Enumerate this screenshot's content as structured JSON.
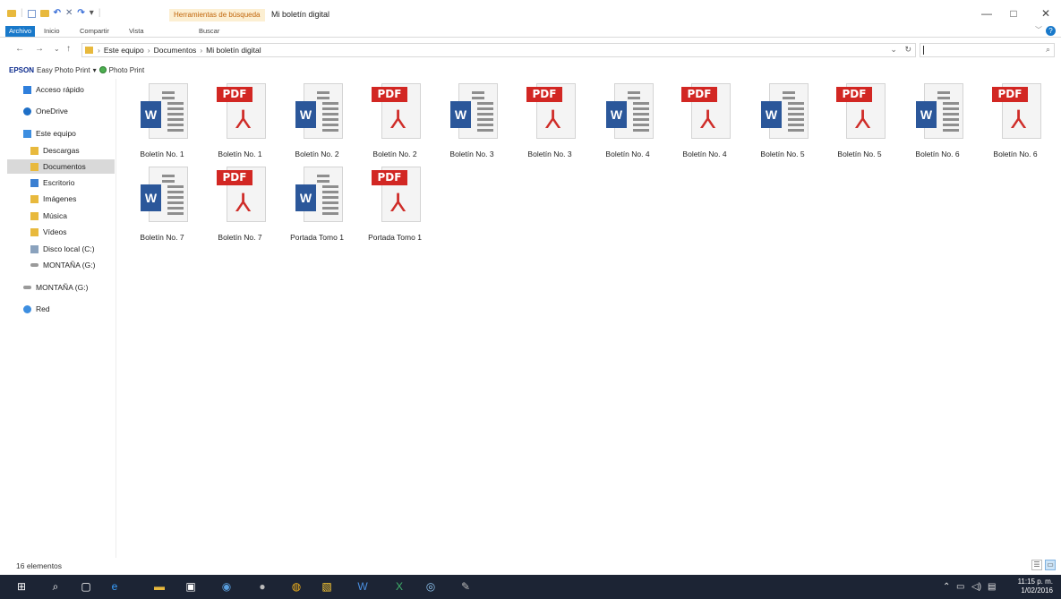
{
  "window": {
    "title": "Mi boletín digital",
    "context_tab": "Herramientas de búsqueda",
    "minimize": "—",
    "maximize": "□",
    "close": "✕"
  },
  "ribbon": {
    "tabs": [
      "Archivo",
      "Inicio",
      "Compartir",
      "Vista",
      "Buscar"
    ]
  },
  "address": {
    "crumbs": [
      "Este equipo",
      "Documentos",
      "Mi boletín digital"
    ],
    "search_value": ""
  },
  "epson": {
    "brand": "EPSON",
    "easy_photo": "Easy Photo Print",
    "photo_print": "Photo Print"
  },
  "sidebar": {
    "items": [
      {
        "label": "Acceso rápido",
        "icon": "star-icon"
      },
      {
        "label": "OneDrive",
        "icon": "cloud-icon"
      },
      {
        "label": "Este equipo",
        "icon": "computer-icon"
      },
      {
        "label": "Descargas",
        "icon": "download-folder-icon"
      },
      {
        "label": "Documentos",
        "icon": "documents-folder-icon",
        "selected": true
      },
      {
        "label": "Escritorio",
        "icon": "desktop-folder-icon"
      },
      {
        "label": "Imágenes",
        "icon": "pictures-folder-icon"
      },
      {
        "label": "Música",
        "icon": "music-folder-icon"
      },
      {
        "label": "Vídeos",
        "icon": "videos-folder-icon"
      },
      {
        "label": "Disco local (C:)",
        "icon": "disk-icon"
      },
      {
        "label": "MONTAÑA (G:)",
        "icon": "usb-drive-icon"
      },
      {
        "label": "MONTAÑA (G:)",
        "icon": "usb-drive-icon"
      },
      {
        "label": "Red",
        "icon": "network-icon"
      }
    ]
  },
  "files": [
    {
      "name": "Boletín No. 1",
      "type": "word"
    },
    {
      "name": "Boletín No. 1",
      "type": "pdf"
    },
    {
      "name": "Boletín No. 2",
      "type": "word"
    },
    {
      "name": "Boletín No. 2",
      "type": "pdf"
    },
    {
      "name": "Boletín No. 3",
      "type": "word"
    },
    {
      "name": "Boletín No. 3",
      "type": "pdf"
    },
    {
      "name": "Boletín No. 4",
      "type": "word"
    },
    {
      "name": "Boletín No. 4",
      "type": "pdf"
    },
    {
      "name": "Boletín No. 5",
      "type": "word"
    },
    {
      "name": "Boletín No. 5",
      "type": "pdf"
    },
    {
      "name": "Boletín No. 6",
      "type": "word"
    },
    {
      "name": "Boletín No. 6",
      "type": "pdf"
    },
    {
      "name": "Boletín No. 7",
      "type": "word"
    },
    {
      "name": "Boletín No. 7",
      "type": "pdf"
    },
    {
      "name": "Portada Tomo 1",
      "type": "word"
    },
    {
      "name": "Portada Tomo 1",
      "type": "pdf"
    }
  ],
  "file_badges": {
    "word": "W",
    "pdf": "PDF"
  },
  "status": {
    "count": "16 elementos"
  },
  "taskbar": {
    "icons": [
      "windows-start-icon",
      "search-icon",
      "task-view-icon",
      "edge-icon",
      "file-explorer-icon",
      "store-icon",
      "app-icon",
      "media-icon",
      "chrome-icon",
      "app2-icon",
      "word-icon",
      "excel-icon",
      "app3-icon",
      "app4-icon"
    ],
    "time": "11:15 p. m.",
    "date": "1/02/2016"
  },
  "colors": {
    "accent": "#1979ca",
    "word": "#2b579a",
    "pdf": "#d22723",
    "taskbar": "#1c2434"
  }
}
